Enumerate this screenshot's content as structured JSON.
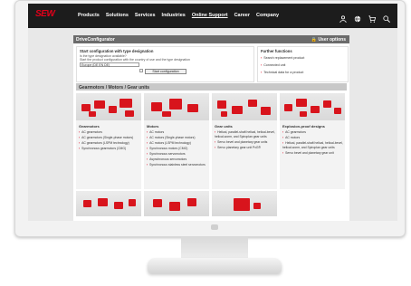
{
  "header": {
    "logo_text": "SEW",
    "nav": [
      "Products",
      "Solutions",
      "Services",
      "Industries",
      "Online Support",
      "Career",
      "Company"
    ],
    "active_nav": "Online Support",
    "icons": [
      "user-icon",
      "globe-icon",
      "cart-icon",
      "search-icon"
    ]
  },
  "configurator": {
    "title": "DriveConfigurator",
    "user_options": "User options",
    "start_heading": "Start configuration with type designation",
    "question": "Is the type designation available?",
    "instruction": "Start the product configuration with the country of use and the type designation",
    "country_value": "Europe (DE EN DE)",
    "start_button": "Start configuration"
  },
  "further_functions": {
    "title": "Further functions",
    "items": [
      "Search replacement product",
      "Connected unit",
      "Technical data for a product"
    ]
  },
  "gearmotors_section": {
    "title": "Gearmotors / Motors / Gear units"
  },
  "cards": [
    {
      "title": "Gearmotors",
      "items": [
        "AC gearmotors",
        "AC gearmotors (Single-phase motors)",
        "AC gearmotors (LSPM technology)",
        "Synchronous gearmotors (CMG)"
      ]
    },
    {
      "title": "Motors",
      "items": [
        "AC motors",
        "AC motors (Single-phase motors)",
        "AC motors (LSPM technology)",
        "Synchronous motors (CMG)",
        "Synchronous servomotors",
        "Asynchronous servomotors",
        "Synchronous stainless steel servomotors"
      ]
    },
    {
      "title": "Gear units",
      "items": [
        "Helical, parallel-shaft helical, helical-bevel, helical-worm, and Spiroplan gear units",
        "Servo bevel and planetary gear units",
        "Servo planetary gear unit PxG®"
      ]
    },
    {
      "title": "Explosion-proof designs",
      "items": [
        "AC gearmotors",
        "AC motors",
        "Helical, parallel-shaft helical, helical-bevel, helical-worm, and Spiroplan gear units",
        "Servo bevel and planetary gear unit"
      ]
    }
  ],
  "colors": {
    "brand_red": "#e2001a",
    "header_bg": "#1c1c1c",
    "config_bar": "#6b6b6b"
  }
}
